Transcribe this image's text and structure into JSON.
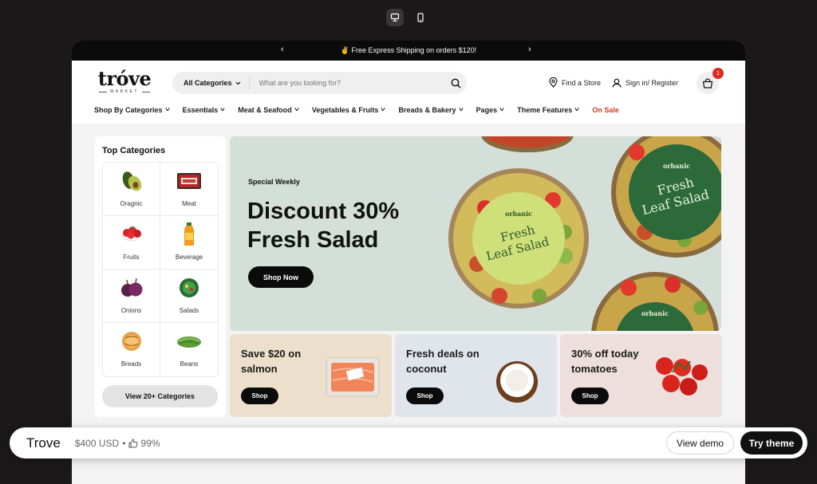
{
  "device_toggle": {
    "desktop_icon": "desktop-icon",
    "mobile_icon": "mobile-icon"
  },
  "announcement": {
    "text": "✌ Free Express Shipping on orders $120!",
    "prev": "‹",
    "next": "›"
  },
  "header": {
    "logo_word": "tróve",
    "logo_sub": "MARKET",
    "search": {
      "category": "All Categories",
      "placeholder": "What are you looking for?"
    },
    "find_store": "Find a Store",
    "sign_in": "Sign in/ Register",
    "cart_count": "1"
  },
  "nav": {
    "items": [
      {
        "label": "Shop By Categories",
        "chevron": "˅"
      },
      {
        "label": "Essentials",
        "chevron": "˅"
      },
      {
        "label": "Meat & Seafood",
        "chevron": "˅"
      },
      {
        "label": "Vegetables & Fruits",
        "chevron": "˅"
      },
      {
        "label": "Breads & Bakery",
        "chevron": "˅"
      },
      {
        "label": "Pages",
        "chevron": "˅"
      },
      {
        "label": "Theme Features",
        "chevron": "˅"
      },
      {
        "label": "On Sale"
      }
    ],
    "sale_color": "#d53a1f"
  },
  "sidebar": {
    "title": "Top Categories",
    "categories": [
      {
        "label": "Oragnic",
        "icon": "avocado-icon"
      },
      {
        "label": "Meat",
        "icon": "meat-icon"
      },
      {
        "label": "Fruits",
        "icon": "strawberries-icon"
      },
      {
        "label": "Beverage",
        "icon": "juice-bottle-icon"
      },
      {
        "label": "Onions",
        "icon": "onions-icon"
      },
      {
        "label": "Salads",
        "icon": "salad-icon"
      },
      {
        "label": "Breads",
        "icon": "bread-icon"
      },
      {
        "label": "Beans",
        "icon": "beans-icon"
      }
    ],
    "view_all": "View 20+ Categories"
  },
  "hero": {
    "eyebrow": "Special Weekly",
    "title_line1": "Discount 30%",
    "title_line2": "Fresh Salad",
    "button": "Shop Now",
    "label_brand": "orbanic",
    "label_title_1": "Fresh",
    "label_title_2": "Leaf Salad",
    "bg_color": "#d4dfd9"
  },
  "promos": [
    {
      "title": "Save $20 on salmon",
      "button": "Shop",
      "bg": "#ece0cc"
    },
    {
      "title": "Fresh deals on coconut",
      "button": "Shop",
      "bg": "#dfe5ea"
    },
    {
      "title": "30% off today tomatoes",
      "button": "Shop",
      "bg": "#ede0dc"
    }
  ],
  "bottom_bar": {
    "name": "Trove",
    "price": "$400 USD",
    "dot": "•",
    "rating": "99%",
    "view_demo": "View demo",
    "try_theme": "Try theme"
  }
}
